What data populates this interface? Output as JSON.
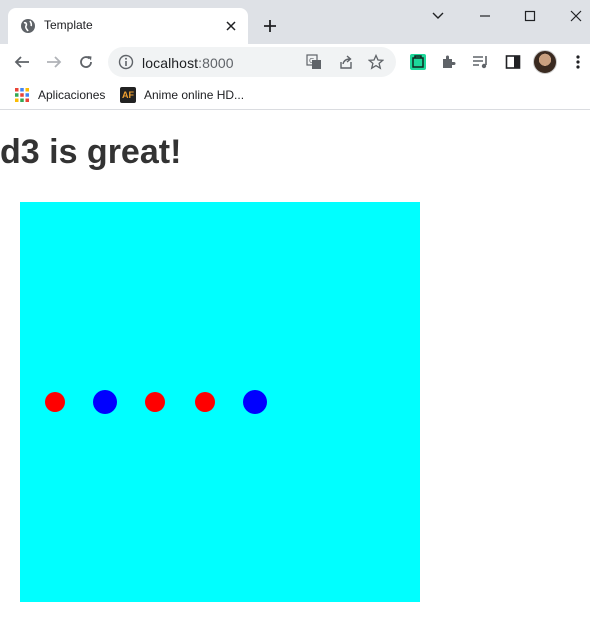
{
  "browser": {
    "tab_title": "Template",
    "url_host": "localhost",
    "url_port": ":8000",
    "bookmarks": [
      {
        "label": "Aplicaciones",
        "icon": "apps-grid-icon"
      },
      {
        "label": "Anime online HD...",
        "icon": "animeflv-icon"
      }
    ]
  },
  "page": {
    "heading": "d3 is great!",
    "svg_background": "#00ffff",
    "circles": [
      {
        "color": "red",
        "size": "small"
      },
      {
        "color": "blue",
        "size": "large"
      },
      {
        "color": "red",
        "size": "small"
      },
      {
        "color": "red",
        "size": "small"
      },
      {
        "color": "blue",
        "size": "large"
      }
    ],
    "circle_colors": {
      "red": "#ff0000",
      "blue": "#0000ff"
    }
  }
}
